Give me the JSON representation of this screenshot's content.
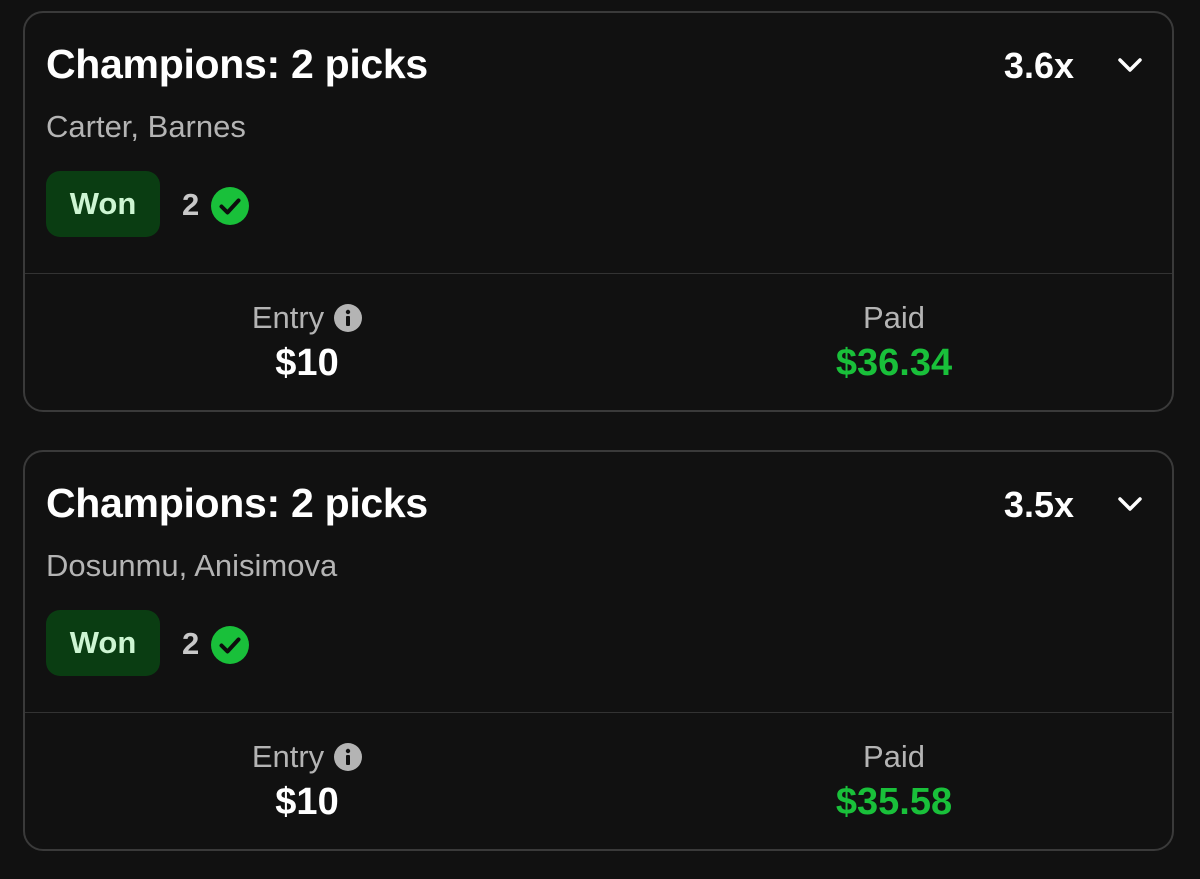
{
  "entries": [
    {
      "title": "Champions: 2 picks",
      "multiplier": "3.6x",
      "players": "Carter, Barnes",
      "status": "Won",
      "correct_count": "2",
      "entry_label": "Entry",
      "entry_value": "$10",
      "paid_label": "Paid",
      "paid_value": "$36.34"
    },
    {
      "title": "Champions: 2 picks",
      "multiplier": "3.5x",
      "players": "Dosunmu, Anisimova",
      "status": "Won",
      "correct_count": "2",
      "entry_label": "Entry",
      "entry_value": "$10",
      "paid_label": "Paid",
      "paid_value": "$35.58"
    }
  ],
  "icons": {
    "expand": "chevron-down-icon",
    "correct": "check-circle-icon",
    "info": "info-icon"
  },
  "colors": {
    "background": "#111111",
    "won_badge_bg": "#0a3d12",
    "won_badge_text": "#cdf5d2",
    "success_green": "#19c03a"
  }
}
